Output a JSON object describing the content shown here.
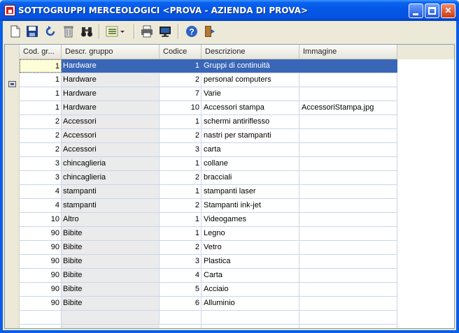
{
  "window": {
    "title": "SOTTOGRUPPI MERCEOLOGICI <PROVA - AZIENDA DI PROVA>"
  },
  "toolbar": {
    "buttons": [
      {
        "icon": "new-document-icon"
      },
      {
        "icon": "save-icon"
      },
      {
        "icon": "refresh-icon"
      },
      {
        "icon": "trash-icon"
      },
      {
        "icon": "binoculars-icon"
      },
      {
        "icon": "list-view-icon"
      },
      {
        "icon": "printer-icon"
      },
      {
        "icon": "monitor-icon"
      },
      {
        "icon": "help-icon"
      },
      {
        "icon": "exit-door-icon"
      }
    ]
  },
  "grid": {
    "columns": [
      "Cod. gr...",
      "Descr. gruppo",
      "Codice",
      "Descrizione",
      "Immagine"
    ],
    "selected_row": 0,
    "rows": [
      {
        "cod_gruppo": "1",
        "descr_gruppo": "Hardware",
        "codice": "1",
        "descrizione": "Gruppi di continuità",
        "immagine": ""
      },
      {
        "cod_gruppo": "1",
        "descr_gruppo": "Hardware",
        "codice": "2",
        "descrizione": "personal computers",
        "immagine": ""
      },
      {
        "cod_gruppo": "1",
        "descr_gruppo": "Hardware",
        "codice": "7",
        "descrizione": "Varie",
        "immagine": ""
      },
      {
        "cod_gruppo": "1",
        "descr_gruppo": "Hardware",
        "codice": "10",
        "descrizione": "Accessori stampa",
        "immagine": "AccessoriStampa.jpg"
      },
      {
        "cod_gruppo": "2",
        "descr_gruppo": "Accessori",
        "codice": "1",
        "descrizione": "schermi antiriflesso",
        "immagine": ""
      },
      {
        "cod_gruppo": "2",
        "descr_gruppo": "Accessori",
        "codice": "2",
        "descrizione": "nastri per stampanti",
        "immagine": ""
      },
      {
        "cod_gruppo": "2",
        "descr_gruppo": "Accessori",
        "codice": "3",
        "descrizione": "carta",
        "immagine": ""
      },
      {
        "cod_gruppo": "3",
        "descr_gruppo": "chincaglieria",
        "codice": "1",
        "descrizione": "collane",
        "immagine": ""
      },
      {
        "cod_gruppo": "3",
        "descr_gruppo": "chincaglieria",
        "codice": "2",
        "descrizione": "bracciali",
        "immagine": ""
      },
      {
        "cod_gruppo": "4",
        "descr_gruppo": "stampanti",
        "codice": "1",
        "descrizione": "stampanti laser",
        "immagine": ""
      },
      {
        "cod_gruppo": "4",
        "descr_gruppo": "stampanti",
        "codice": "2",
        "descrizione": "Stampanti  ink-jet",
        "immagine": ""
      },
      {
        "cod_gruppo": "10",
        "descr_gruppo": "Altro",
        "codice": "1",
        "descrizione": "Videogames",
        "immagine": ""
      },
      {
        "cod_gruppo": "90",
        "descr_gruppo": "Bibite",
        "codice": "1",
        "descrizione": "Legno",
        "immagine": ""
      },
      {
        "cod_gruppo": "90",
        "descr_gruppo": "Bibite",
        "codice": "2",
        "descrizione": "Vetro",
        "immagine": ""
      },
      {
        "cod_gruppo": "90",
        "descr_gruppo": "Bibite",
        "codice": "3",
        "descrizione": "Plastica",
        "immagine": ""
      },
      {
        "cod_gruppo": "90",
        "descr_gruppo": "Bibite",
        "codice": "4",
        "descrizione": "Carta",
        "immagine": ""
      },
      {
        "cod_gruppo": "90",
        "descr_gruppo": "Bibite",
        "codice": "5",
        "descrizione": "Acciaio",
        "immagine": ""
      },
      {
        "cod_gruppo": "90",
        "descr_gruppo": "Bibite",
        "codice": "6",
        "descrizione": "Alluminio",
        "immagine": ""
      }
    ]
  },
  "colors": {
    "selection": "#3a66b8",
    "gridline": "#c9d6ea",
    "titlebar": "#0553e0"
  }
}
